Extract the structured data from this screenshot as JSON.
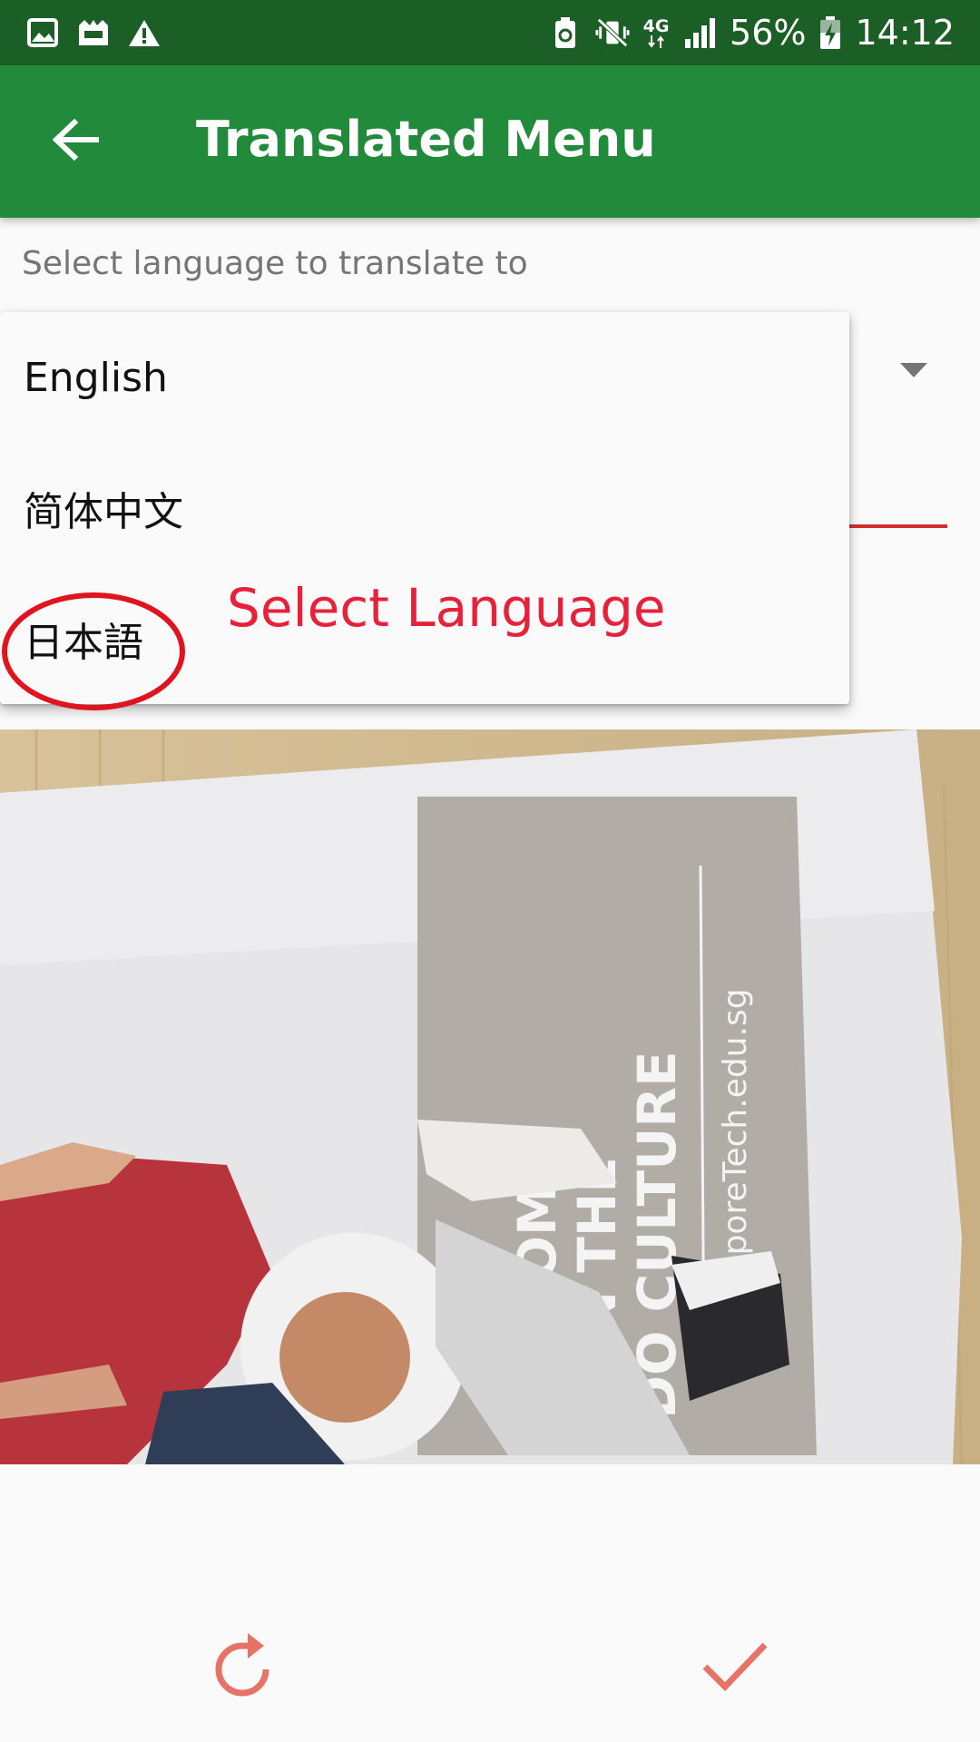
{
  "status_bar": {
    "network": "4G",
    "battery_percent": "56%",
    "time": "14:12"
  },
  "app_bar": {
    "title": "Translated Menu"
  },
  "language_prompt": "Select language to translate to",
  "language_options": [
    "English",
    "简体中文",
    "日本語"
  ],
  "annotation": {
    "label": "Select Language",
    "color": "#e8213a"
  },
  "photo": {
    "poster_lines": [
      "COME",
      "JOIN THE",
      "DO CULTURE"
    ],
    "poster_url": "SingaporeTech.edu.sg"
  },
  "colors": {
    "status_bar": "#1b5e26",
    "app_bar": "#218a3b",
    "accent": "#e57368",
    "underline": "#d32f2f"
  },
  "icons": {
    "back": "arrow-left-icon",
    "reset": "rotate-right-icon",
    "confirm": "checkmark-icon"
  }
}
